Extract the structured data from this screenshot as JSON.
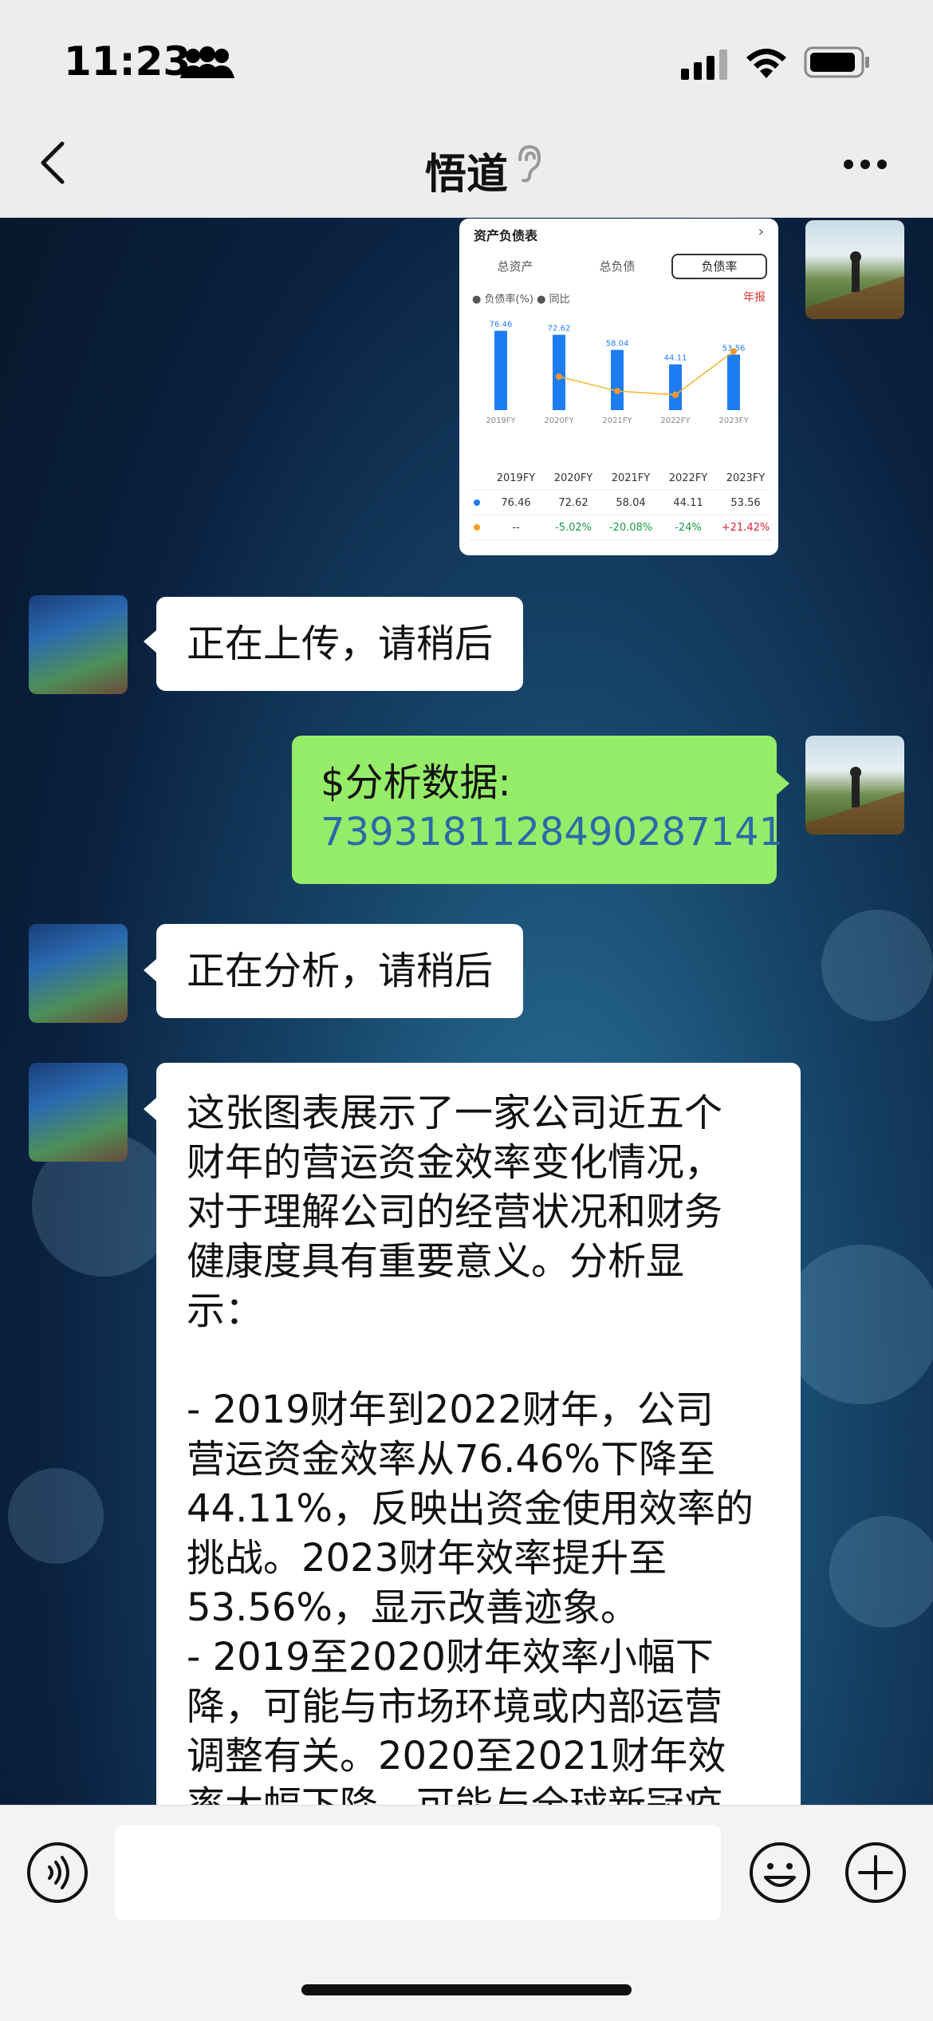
{
  "status": {
    "time": "11:23"
  },
  "header": {
    "title": "悟道"
  },
  "messages": {
    "m1_image": {
      "card_title": "资产负债表",
      "tabs": [
        "总资产",
        "总负债",
        "负债率"
      ],
      "legend": "● 负债率(%)  ● 同比",
      "period": "年报",
      "chart_data": {
        "type": "bar",
        "categories": [
          "2019FY",
          "2020FY",
          "2021FY",
          "2022FY",
          "2023FY"
        ],
        "series": [
          {
            "name": "负债率(%)",
            "values": [
              76.46,
              72.62,
              58.04,
              44.11,
              53.56
            ]
          },
          {
            "name": "同比",
            "values": [
              null,
              -5.02,
              -20.08,
              -24,
              21.42
            ]
          }
        ],
        "table": {
          "header": [
            "2019FY",
            "2020FY",
            "2021FY",
            "2022FY",
            "2023FY"
          ],
          "row1": [
            "76.46",
            "72.62",
            "58.04",
            "44.11",
            "53.56"
          ],
          "row2": [
            "--",
            "-5.02%",
            "-20.08%",
            "-24%",
            "+21.42%"
          ]
        }
      }
    },
    "m2": "正在上传，请稍后",
    "m3_line1": "$分析数据:",
    "m3_line2": "7393181128490287141",
    "m4": "正在分析，请稍后",
    "m5_lines": [
      "这张图表展示了一家公司近五个",
      "财年的营运资金效率变化情况，",
      "对于理解公司的经营状况和财务",
      "健康度具有重要意义。分析显",
      "示：",
      "",
      "- 2019财年到2022财年，公司",
      "营运资金效率从76.46%下降至",
      "44.11%，反映出资金使用效率的",
      "挑战。2023财年效率提升至",
      "53.56%，显示改善迹象。",
      "- 2019至2020财年效率小幅下",
      "降，可能与市场环境或内部运营",
      "调整有关。2020至2021财年效",
      "率大幅下降，可能与全球新冠疫"
    ]
  },
  "input": {
    "value": ""
  }
}
